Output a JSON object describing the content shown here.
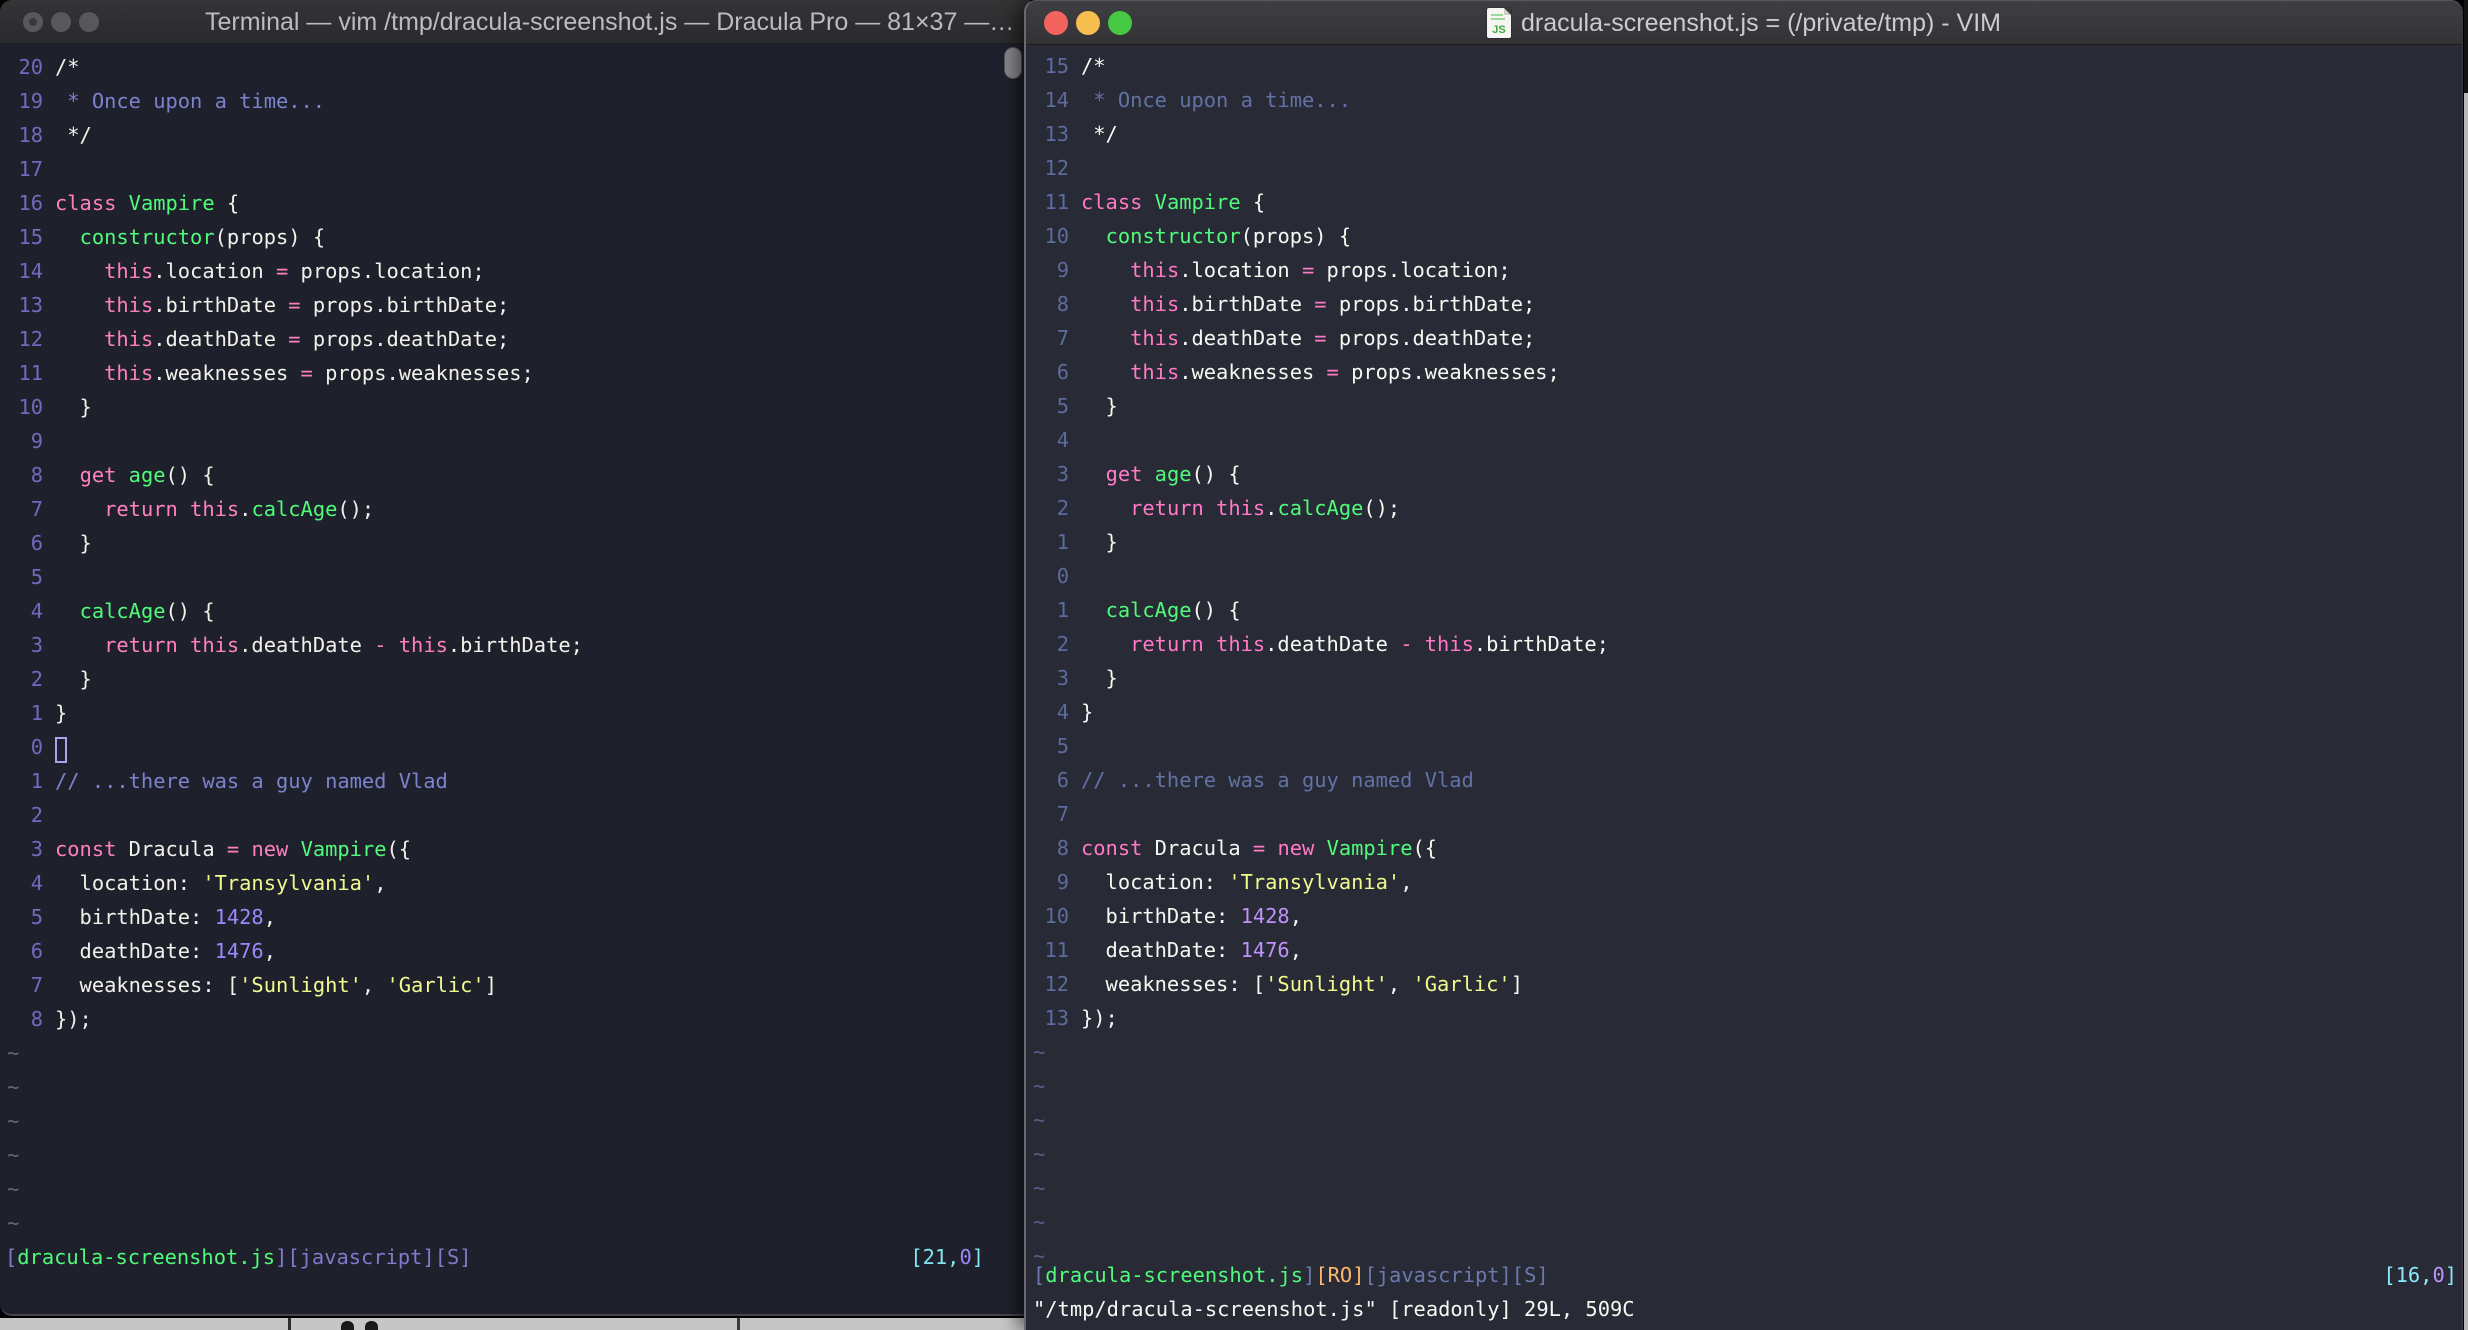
{
  "left_window": {
    "title": "Terminal — vim /tmp/dracula-screenshot.js — Dracula Pro — 81×37 —…",
    "colors": {
      "bg": "#1e212b",
      "fg": "#f2f1ea",
      "keyword": "#ff80bf",
      "function": "#50fa7b",
      "comment": "#7c82cc",
      "string": "#f2f98e",
      "number": "#9e87fa",
      "linenr": "#7568c0",
      "tilde": "#636879",
      "status_bracket": "#8278cc",
      "cyan": "#82e6f0"
    },
    "lines": [
      [
        "20",
        [
          [
            "w",
            "/*"
          ]
        ]
      ],
      [
        "19",
        [
          [
            "c",
            " * Once upon a time..."
          ]
        ]
      ],
      [
        "18",
        [
          [
            "w",
            " */"
          ]
        ]
      ],
      [
        "17",
        []
      ],
      [
        "16",
        [
          [
            "k",
            "class "
          ],
          [
            "f",
            "Vampire"
          ],
          [
            "w",
            " {"
          ]
        ]
      ],
      [
        "15",
        [
          [
            "w",
            "  "
          ],
          [
            "f",
            "constructor"
          ],
          [
            "w",
            "(props) {"
          ]
        ]
      ],
      [
        "14",
        [
          [
            "w",
            "    "
          ],
          [
            "k",
            "this"
          ],
          [
            "w",
            ".location "
          ],
          [
            "k",
            "="
          ],
          [
            "w",
            " props.location;"
          ]
        ]
      ],
      [
        "13",
        [
          [
            "w",
            "    "
          ],
          [
            "k",
            "this"
          ],
          [
            "w",
            ".birthDate "
          ],
          [
            "k",
            "="
          ],
          [
            "w",
            " props.birthDate;"
          ]
        ]
      ],
      [
        "12",
        [
          [
            "w",
            "    "
          ],
          [
            "k",
            "this"
          ],
          [
            "w",
            ".deathDate "
          ],
          [
            "k",
            "="
          ],
          [
            "w",
            " props.deathDate;"
          ]
        ]
      ],
      [
        "11",
        [
          [
            "w",
            "    "
          ],
          [
            "k",
            "this"
          ],
          [
            "w",
            ".weaknesses "
          ],
          [
            "k",
            "="
          ],
          [
            "w",
            " props.weaknesses;"
          ]
        ]
      ],
      [
        "10",
        [
          [
            "w",
            "  }"
          ]
        ]
      ],
      [
        "9",
        []
      ],
      [
        "8",
        [
          [
            "w",
            "  "
          ],
          [
            "k",
            "get "
          ],
          [
            "f",
            "age"
          ],
          [
            "w",
            "() {"
          ]
        ]
      ],
      [
        "7",
        [
          [
            "w",
            "    "
          ],
          [
            "k",
            "return "
          ],
          [
            "k",
            "this"
          ],
          [
            "w",
            "."
          ],
          [
            "f",
            "calcAge"
          ],
          [
            "w",
            "();"
          ]
        ]
      ],
      [
        "6",
        [
          [
            "w",
            "  }"
          ]
        ]
      ],
      [
        "5",
        []
      ],
      [
        "4",
        [
          [
            "w",
            "  "
          ],
          [
            "f",
            "calcAge"
          ],
          [
            "w",
            "() {"
          ]
        ]
      ],
      [
        "3",
        [
          [
            "w",
            "    "
          ],
          [
            "k",
            "return "
          ],
          [
            "k",
            "this"
          ],
          [
            "w",
            ".deathDate "
          ],
          [
            "k",
            "-"
          ],
          [
            "w",
            " "
          ],
          [
            "k",
            "this"
          ],
          [
            "w",
            ".birthDate;"
          ]
        ]
      ],
      [
        "2",
        [
          [
            "w",
            "  }"
          ]
        ]
      ],
      [
        "1",
        [
          [
            "w",
            "}"
          ]
        ]
      ],
      [
        "0",
        [
          [
            "cur",
            ""
          ]
        ]
      ],
      [
        "1",
        [
          [
            "c",
            "// ...there was a guy named Vlad"
          ]
        ]
      ],
      [
        "2",
        []
      ],
      [
        "3",
        [
          [
            "k",
            "const "
          ],
          [
            "w",
            "Dracula "
          ],
          [
            "k",
            "="
          ],
          [
            "w",
            " "
          ],
          [
            "k",
            "new "
          ],
          [
            "f",
            "Vampire"
          ],
          [
            "w",
            "({"
          ]
        ]
      ],
      [
        "4",
        [
          [
            "w",
            "  location: "
          ],
          [
            "s",
            "'Transylvania'"
          ],
          [
            "w",
            ","
          ]
        ]
      ],
      [
        "5",
        [
          [
            "w",
            "  birthDate: "
          ],
          [
            "n",
            "1428"
          ],
          [
            "w",
            ","
          ]
        ]
      ],
      [
        "6",
        [
          [
            "w",
            "  deathDate: "
          ],
          [
            "n",
            "1476"
          ],
          [
            "w",
            ","
          ]
        ]
      ],
      [
        "7",
        [
          [
            "w",
            "  weaknesses: ["
          ],
          [
            "s",
            "'Sunlight'"
          ],
          [
            "w",
            ", "
          ],
          [
            "s",
            "'Garlic'"
          ],
          [
            "w",
            "]"
          ]
        ]
      ],
      [
        "8",
        [
          [
            "w",
            "});"
          ]
        ]
      ]
    ],
    "tilde_count": 6,
    "status_left": [
      [
        "br",
        "["
      ],
      [
        "g",
        "dracula-screenshot.js"
      ],
      [
        "br",
        "]["
      ],
      [
        "br",
        "javascript"
      ],
      [
        "br",
        "]["
      ],
      [
        "br",
        "S"
      ],
      [
        "br",
        "]"
      ]
    ],
    "status_right": [
      [
        "cy",
        "[21,"
      ],
      [
        "pu",
        "0"
      ],
      [
        "cy",
        "]"
      ]
    ]
  },
  "right_window": {
    "title": "dracula-screenshot.js = (/private/tmp) - VIM",
    "icon": "js-file-icon",
    "traffic_lights": {
      "close": "#f4645f",
      "minimize": "#f6bd4f",
      "zoom": "#47c845"
    },
    "colors": {
      "bg": "#282a36",
      "fg": "#f8f8f2",
      "keyword": "#ff79c6",
      "function": "#50fa7b",
      "comment": "#6272a4",
      "string": "#f1fa8c",
      "number": "#bd93f9",
      "linenr": "#5d6b9e",
      "tilde": "#566084",
      "status_bracket": "#6b79ad",
      "cyan": "#8be9fd",
      "readonly_flag": "#ffb86c"
    },
    "lines": [
      [
        "15",
        [
          [
            "w",
            "/*"
          ]
        ]
      ],
      [
        "14",
        [
          [
            "c",
            " * Once upon a time..."
          ]
        ]
      ],
      [
        "13",
        [
          [
            "w",
            " */"
          ]
        ]
      ],
      [
        "12",
        []
      ],
      [
        "11",
        [
          [
            "k",
            "class "
          ],
          [
            "f",
            "Vampire"
          ],
          [
            "w",
            " {"
          ]
        ]
      ],
      [
        "10",
        [
          [
            "w",
            "  "
          ],
          [
            "f",
            "constructor"
          ],
          [
            "w",
            "(props) {"
          ]
        ]
      ],
      [
        "9",
        [
          [
            "w",
            "    "
          ],
          [
            "k",
            "this"
          ],
          [
            "w",
            ".location "
          ],
          [
            "k",
            "="
          ],
          [
            "w",
            " props.location;"
          ]
        ]
      ],
      [
        "8",
        [
          [
            "w",
            "    "
          ],
          [
            "k",
            "this"
          ],
          [
            "w",
            ".birthDate "
          ],
          [
            "k",
            "="
          ],
          [
            "w",
            " props.birthDate;"
          ]
        ]
      ],
      [
        "7",
        [
          [
            "w",
            "    "
          ],
          [
            "k",
            "this"
          ],
          [
            "w",
            ".deathDate "
          ],
          [
            "k",
            "="
          ],
          [
            "w",
            " props.deathDate;"
          ]
        ]
      ],
      [
        "6",
        [
          [
            "w",
            "    "
          ],
          [
            "k",
            "this"
          ],
          [
            "w",
            ".weaknesses "
          ],
          [
            "k",
            "="
          ],
          [
            "w",
            " props.weaknesses;"
          ]
        ]
      ],
      [
        "5",
        [
          [
            "w",
            "  }"
          ]
        ]
      ],
      [
        "4",
        []
      ],
      [
        "3",
        [
          [
            "w",
            "  "
          ],
          [
            "k",
            "get "
          ],
          [
            "f",
            "age"
          ],
          [
            "w",
            "() {"
          ]
        ]
      ],
      [
        "2",
        [
          [
            "w",
            "    "
          ],
          [
            "k",
            "return "
          ],
          [
            "k",
            "this"
          ],
          [
            "w",
            "."
          ],
          [
            "f",
            "calcAge"
          ],
          [
            "w",
            "();"
          ]
        ]
      ],
      [
        "1",
        [
          [
            "w",
            "  }"
          ]
        ]
      ],
      [
        "0",
        []
      ],
      [
        "1",
        [
          [
            "w",
            "  "
          ],
          [
            "f",
            "calcAge"
          ],
          [
            "w",
            "() {"
          ]
        ]
      ],
      [
        "2",
        [
          [
            "w",
            "    "
          ],
          [
            "k",
            "return "
          ],
          [
            "k",
            "this"
          ],
          [
            "w",
            ".deathDate "
          ],
          [
            "k",
            "-"
          ],
          [
            "w",
            " "
          ],
          [
            "k",
            "this"
          ],
          [
            "w",
            ".birthDate;"
          ]
        ]
      ],
      [
        "3",
        [
          [
            "w",
            "  }"
          ]
        ]
      ],
      [
        "4",
        [
          [
            "w",
            "}"
          ]
        ]
      ],
      [
        "5",
        []
      ],
      [
        "6",
        [
          [
            "c",
            "// ...there was a guy named Vlad"
          ]
        ]
      ],
      [
        "7",
        []
      ],
      [
        "8",
        [
          [
            "k",
            "const "
          ],
          [
            "w",
            "Dracula "
          ],
          [
            "k",
            "="
          ],
          [
            "w",
            " "
          ],
          [
            "k",
            "new "
          ],
          [
            "f",
            "Vampire"
          ],
          [
            "w",
            "({"
          ]
        ]
      ],
      [
        "9",
        [
          [
            "w",
            "  location: "
          ],
          [
            "s",
            "'Transylvania'"
          ],
          [
            "w",
            ","
          ]
        ]
      ],
      [
        "10",
        [
          [
            "w",
            "  birthDate: "
          ],
          [
            "n",
            "1428"
          ],
          [
            "w",
            ","
          ]
        ]
      ],
      [
        "11",
        [
          [
            "w",
            "  deathDate: "
          ],
          [
            "n",
            "1476"
          ],
          [
            "w",
            ","
          ]
        ]
      ],
      [
        "12",
        [
          [
            "w",
            "  weaknesses: ["
          ],
          [
            "s",
            "'Sunlight'"
          ],
          [
            "w",
            ", "
          ],
          [
            "s",
            "'Garlic'"
          ],
          [
            "w",
            "]"
          ]
        ]
      ],
      [
        "13",
        [
          [
            "w",
            "});"
          ]
        ]
      ]
    ],
    "tilde_count": 7,
    "status_left": [
      [
        "br",
        "["
      ],
      [
        "g",
        "dracula-screenshot.js"
      ],
      [
        "br",
        "]"
      ],
      [
        "o",
        "[RO]"
      ],
      [
        "br",
        "["
      ],
      [
        "br",
        "javascript"
      ],
      [
        "br",
        "]["
      ],
      [
        "br",
        "S"
      ],
      [
        "br",
        "]"
      ]
    ],
    "status_right": [
      [
        "cy",
        "[16,"
      ],
      [
        "pu",
        "0"
      ],
      [
        "cy",
        "]"
      ]
    ],
    "command_line": "\"/tmp/dracula-screenshot.js\" [readonly] 29L, 509C"
  }
}
